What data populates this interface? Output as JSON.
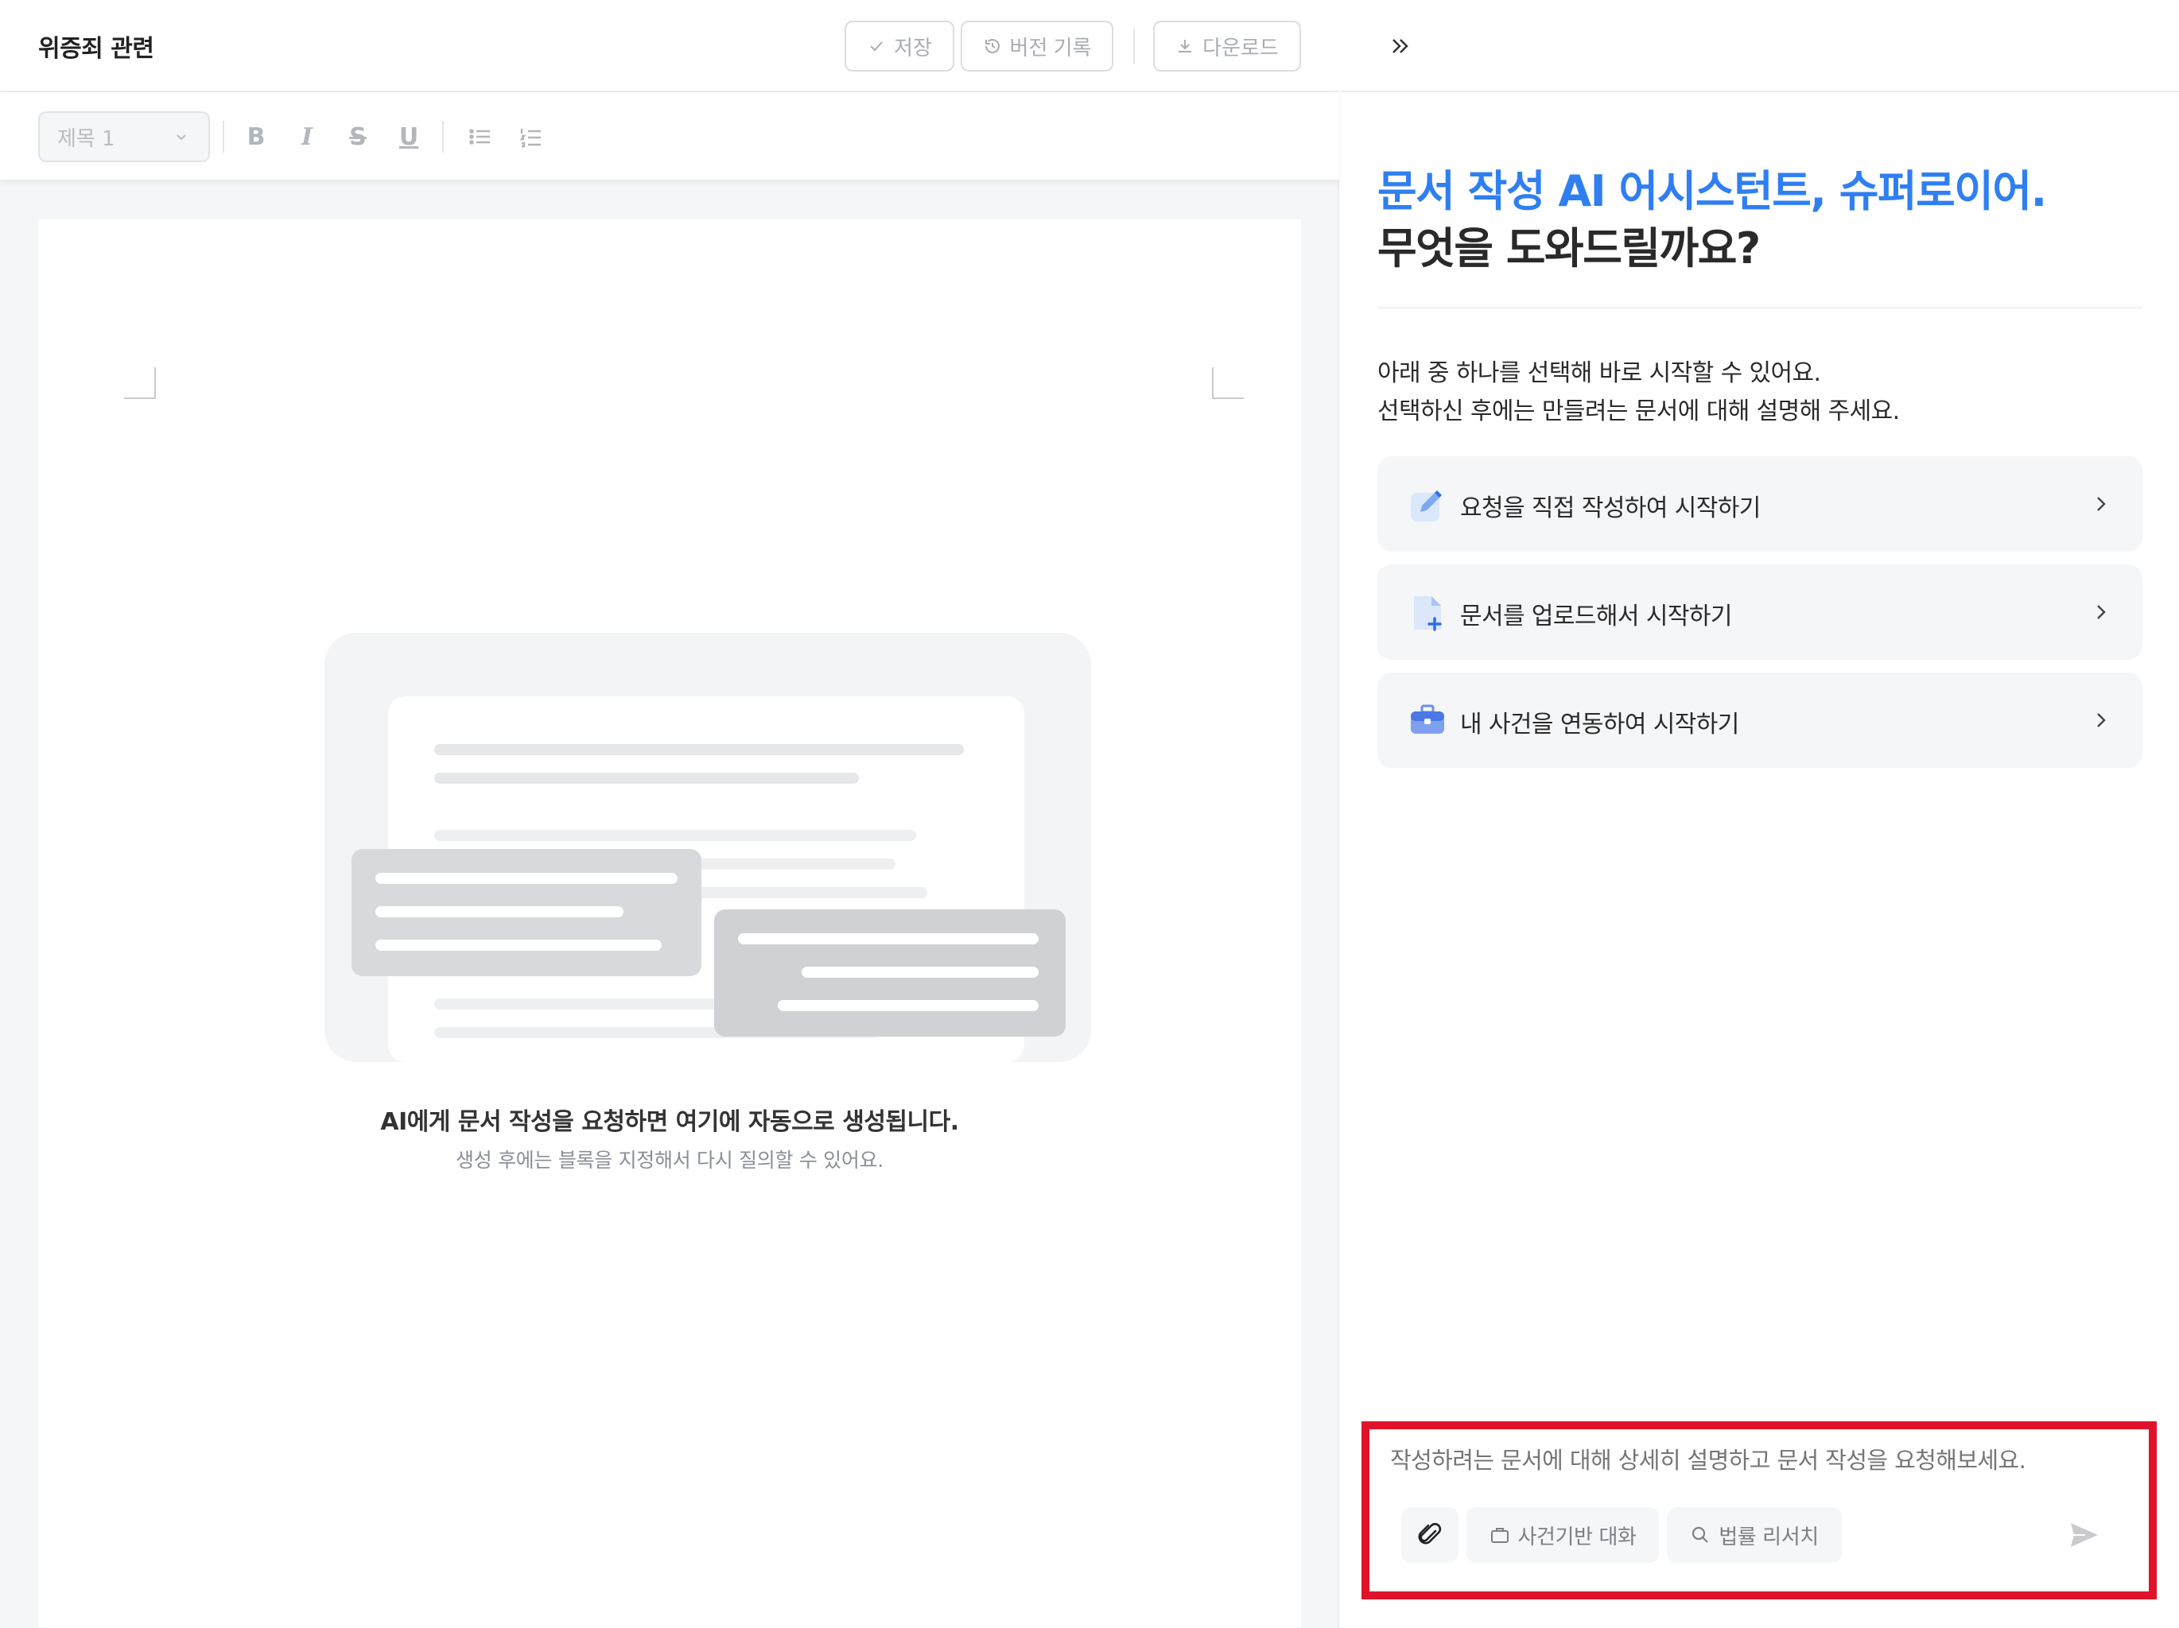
{
  "editor": {
    "document_title": "위증죄 관련",
    "toolbar": {
      "save_label": "저장",
      "version_label": "버전 기록",
      "download_label": "다운로드"
    },
    "format": {
      "heading_value": "제목 1",
      "bold": "B",
      "italic": "I",
      "strike": "S",
      "underline": "U"
    },
    "empty_state": {
      "title": "AI에게 문서 작성을 요청하면 여기에 자동으로 생성됩니다.",
      "subtitle": "생성 후에는 블록을 지정해서 다시 질의할 수 있어요."
    }
  },
  "assistant": {
    "greeting_line1": "문서 작성 AI 어시스턴트, 슈퍼로이어.",
    "greeting_line2": "무엇을 도와드릴까요?",
    "intro_line1": "아래 중 하나를 선택해 바로 시작할 수 있어요.",
    "intro_line2": "선택하신 후에는 만들려는 문서에 대해 설명해 주세요.",
    "options": [
      {
        "label": "요청을 직접 작성하여 시작하기",
        "icon": "edit-icon"
      },
      {
        "label": "문서를 업로드해서 시작하기",
        "icon": "file-upload-icon"
      },
      {
        "label": "내 사건을 연동하여 시작하기",
        "icon": "briefcase-icon"
      }
    ],
    "composer": {
      "placeholder": "작성하려는 문서에 대해 상세히 설명하고 문서 작성을 요청해보세요.",
      "chip_case": "사건기반 대화",
      "chip_law": "법률 리서치"
    }
  },
  "colors": {
    "accent": "#2f7ff2",
    "highlight": "#e0122a",
    "muted": "#a9adb3"
  }
}
